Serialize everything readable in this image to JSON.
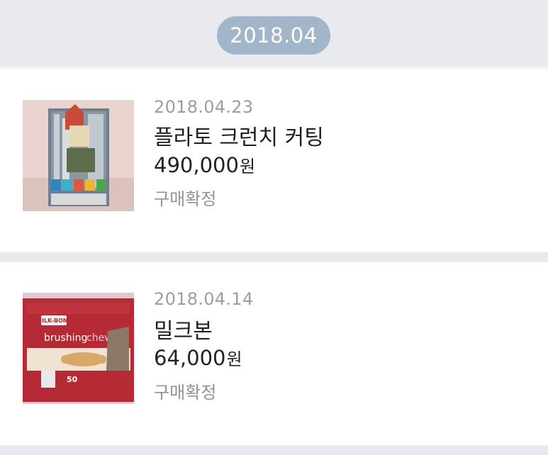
{
  "month_label": "2018.04",
  "orders": [
    {
      "date": "2018.04.23",
      "product_name": "플라토 크런치 커팅",
      "price": "490,000",
      "currency": "원",
      "status": "구매확정",
      "thumbnail_icon": "product-bag-photo"
    },
    {
      "date": "2018.04.14",
      "product_name": "밀크본",
      "price": "64,000",
      "currency": "원",
      "status": "구매확정",
      "thumbnail_icon": "product-box-photo",
      "thumbnail_text": {
        "brand": "MILK-BONE",
        "line1": "brushing",
        "line2": "chews",
        "count": "50"
      }
    }
  ]
}
